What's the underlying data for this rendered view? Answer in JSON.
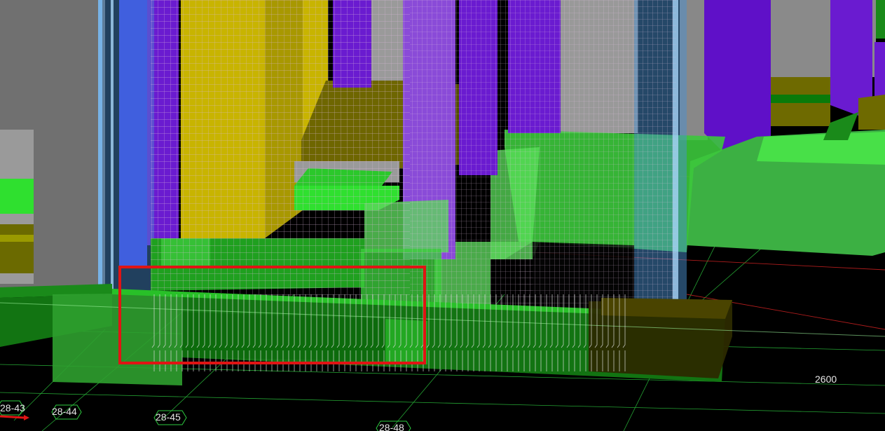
{
  "viewport": {
    "background": "#000000",
    "grid_line_color": "#2ecc40",
    "axis_line_color": "#cc2222"
  },
  "colors": {
    "slab_green": "#3cb043",
    "slab_bright_green": "#44e044",
    "dark_green": "#0b6b0b",
    "purple_column": "#6a1bd0",
    "yellow_wall": "#c8b400",
    "olive_beam": "#7a7200",
    "grey_wall": "#8a8a8a",
    "blue_glass": "#4a8fd0",
    "mesh_lines": "#d9b8d9",
    "highlight_box": "#e01414"
  },
  "grid_labels": [
    {
      "id": "28-43",
      "text": "28-43"
    },
    {
      "id": "28-44",
      "text": "28-44"
    },
    {
      "id": "28-45",
      "text": "28-45"
    },
    {
      "id": "28-48",
      "text": "28-48"
    }
  ],
  "dimension_label": "2600",
  "highlight": {
    "description_color": "#e01414"
  }
}
